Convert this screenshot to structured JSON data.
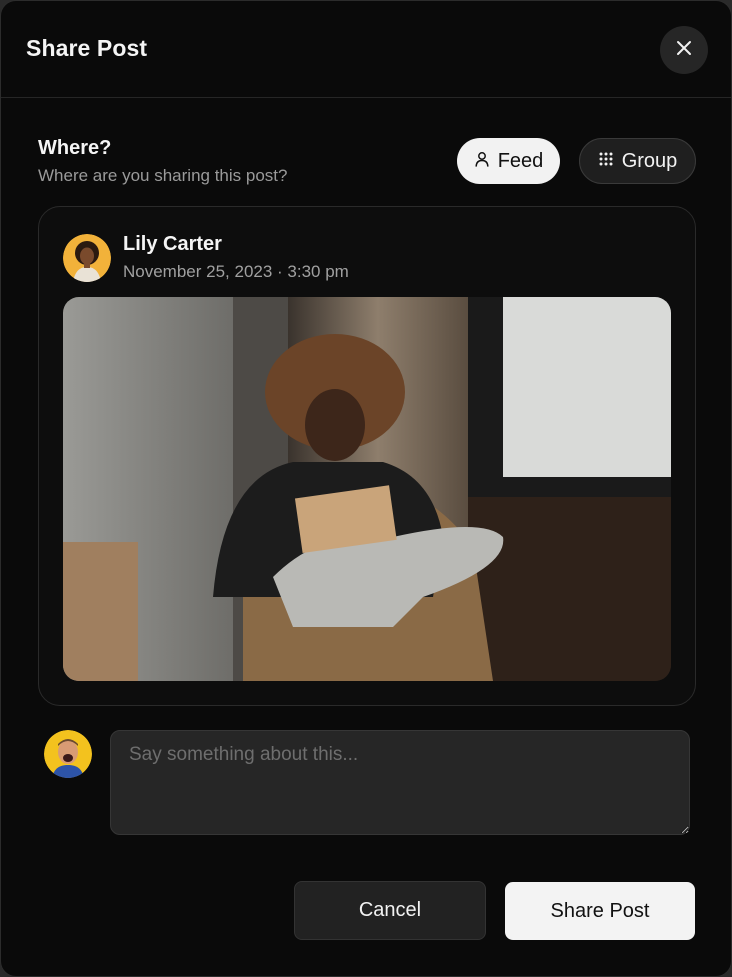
{
  "dialog": {
    "title": "Share Post",
    "close_icon": "close-icon"
  },
  "where": {
    "title": "Where?",
    "subtitle": "Where are you sharing this post?",
    "options": [
      {
        "label": "Feed",
        "icon": "user-icon",
        "selected": true
      },
      {
        "label": "Group",
        "icon": "grid-dots-icon",
        "selected": false
      }
    ]
  },
  "post": {
    "author": "Lily Carter",
    "timestamp": "November 25, 2023 · 3:30 pm",
    "image_alt": "Woman reading a book in a wicker chair by a window"
  },
  "comment": {
    "placeholder": "Say something about this...",
    "value": ""
  },
  "actions": {
    "cancel_label": "Cancel",
    "share_label": "Share Post"
  },
  "colors": {
    "background": "#0a0a0a",
    "text": "#f5f5f5",
    "muted": "#9a9a9a",
    "primary_button": "#f3f3f3",
    "secondary_button": "#222222"
  }
}
